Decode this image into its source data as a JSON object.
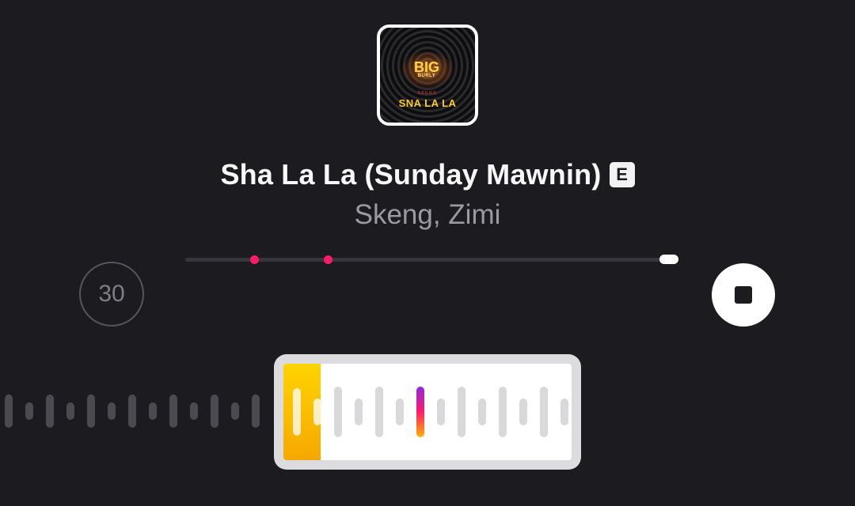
{
  "album": {
    "logo_line1": "BIG",
    "logo_line2": "BURLY",
    "tag": "SKENG",
    "title": "SNA LA LA",
    "subtitle": ""
  },
  "track": {
    "title": "Sha La La (Sunday Mawnin)",
    "explicit_label": "E",
    "artist": "Skeng, Zimi"
  },
  "controls": {
    "skip_label": "30",
    "stop_icon": "stop-icon"
  },
  "progress": {
    "fraction": 0.98,
    "markers": [
      0.14,
      0.29
    ]
  },
  "waveform": {
    "left_bar_heights": [
      42,
      22,
      42,
      22,
      42,
      22,
      42,
      22,
      42,
      22,
      42,
      22,
      42
    ],
    "selection_bar_heights": [
      60,
      34,
      64,
      34,
      64,
      34,
      64,
      34,
      64,
      34,
      64,
      34,
      64,
      34
    ],
    "playhead_index": 6,
    "played_fraction": 0.13
  },
  "colors": {
    "background": "#1c1c20",
    "accent": "#ff1a6a",
    "played": "#ffd400"
  }
}
